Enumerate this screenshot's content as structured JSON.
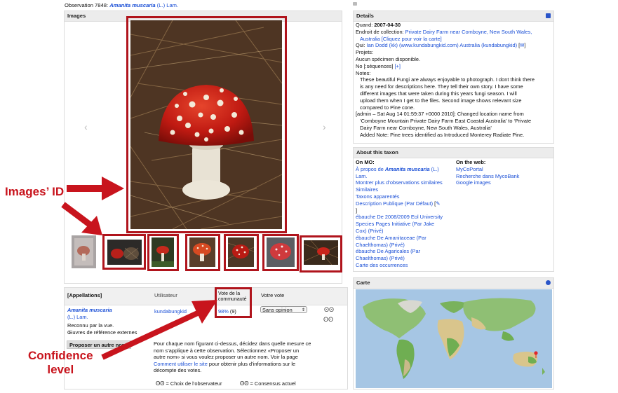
{
  "header": {
    "observation_prefix": "Observation 7848:",
    "taxon_name": "Amanita muscaria",
    "taxon_author": "(L.) Lam."
  },
  "images_panel": {
    "title": "Images",
    "prev_arrow": "‹",
    "next_arrow": "›"
  },
  "details_panel": {
    "title": "Details",
    "print_icon": "printer-icon",
    "lines": {
      "quand_label": "Quand:",
      "quand_value": "2007-04-30",
      "endroit_label": "Endroit de collection:",
      "endroit_link": "Private Dairy Farm near Comboyne, New South Wales,",
      "endroit_link2": "Australia",
      "carte_link": "[Cliquez pour voir la carte]",
      "qui_label": "Qui:",
      "qui_link": "Ian Dodd (kk) (www.kundabungkid.com) Australia (kundabungkid)",
      "projets": "Projets:",
      "aucun": "Aucun spécimen disponible.",
      "no_seq": "No [:séquences]",
      "add_seq": "[+]",
      "notes_label": "Notes:",
      "notes": [
        "These beautiful Fungi are always enjoyable to photograph. I dont think there",
        "is any need for descriptions here. They tell their own story. I have some",
        "different images that were taken during this years fungi season. I will",
        "upload them when I get to the files. Second image shows relevant size",
        "compared to Pine cone."
      ],
      "admin": [
        "[admin – Sat Aug 14 01:59:37 +0000 2010]: Changed location name from",
        "‘Comboyne Mountain Private Dairy Farm East Coastal Australia’ to ‘Private",
        "Dairy Farm near Comboyne, New South Wales, Australia’",
        "Added Note: Pine trees identified as Introduced Monterey Radiate Pine."
      ]
    }
  },
  "taxon_panel": {
    "title": "About this taxon",
    "on_mo": "On MO:",
    "on_web": "On the web:",
    "mo_links": [
      {
        "pre": "À propos de ",
        "bold": "Amanita muscaria",
        "post": " (L.)"
      },
      {
        "pre": "Lam.",
        "bold": "",
        "post": ""
      },
      {
        "pre": "Montrer plus d’observations similaires",
        "bold": "",
        "post": ""
      },
      {
        "pre": "Similaires",
        "bold": "",
        "post": ""
      },
      {
        "pre": "Taxons apparentés",
        "bold": "",
        "post": ""
      },
      {
        "pre": "Description Publique (Par Défaut)",
        "bold": "",
        "post": ""
      },
      {
        "pre": "]",
        "bold": "",
        "post": ""
      },
      {
        "pre": "ébauche De 2008/2009 Eol University",
        "bold": "",
        "post": ""
      },
      {
        "pre": "Species Pages Initiative (Par Jake",
        "bold": "",
        "post": ""
      },
      {
        "pre": "Cox) (Privé)",
        "bold": "",
        "post": ""
      },
      {
        "pre": "ébauche De Amanitaceae (Par",
        "bold": "",
        "post": ""
      },
      {
        "pre": "Chaelthomas) (Privé)",
        "bold": "",
        "post": ""
      },
      {
        "pre": "ébauche De Agaricales (Par",
        "bold": "",
        "post": ""
      },
      {
        "pre": "Chaelthomas) (Privé)",
        "bold": "",
        "post": ""
      },
      {
        "pre": "Carte des occurrences",
        "bold": "",
        "post": ""
      }
    ],
    "web_links": [
      "MyCoPortal",
      "Recherche dans MycoBank",
      "Google images"
    ]
  },
  "map_panel": {
    "title": "Carte"
  },
  "names_table": {
    "headers": {
      "appellations": "[Appellations]",
      "utilisateur": "Utilisateur",
      "vote_communaute_1": "Vote de la",
      "vote_communaute_2": "communauté",
      "votre_vote": "Votre vote"
    },
    "row": {
      "name": "Amanita muscaria",
      "author": "(L.) Lam.",
      "reconnu": "Reconnu par la vue.",
      "oeuvres": "Œuvres de référence externes",
      "user": "kundabungkid",
      "vote_percent": "98%",
      "vote_count": "(9)",
      "select_value": "Sans opinion"
    },
    "propose_button": "Proposer un autre nom",
    "help_text": [
      "Pour chaque nom figurant ci-dessus, décidez dans quelle mesure ce",
      "nom s’applique à cette observation. Sélectionnez «Proposer un",
      "autre nom» si vous voulez proposer un autre nom. Voir la page"
    ],
    "help_link": "Comment utiliser le site",
    "help_after_link": " pour obtenir plus d’informations sur le",
    "help_last": "décompte des votes.",
    "legend_observer": "= Choix de l’observateur",
    "legend_consensus": "= Consensus actuel"
  },
  "annotations": {
    "images_id": "Images’ ID",
    "confidence_1": "Confidence",
    "confidence_2": "level",
    "color": "#c8141d"
  }
}
